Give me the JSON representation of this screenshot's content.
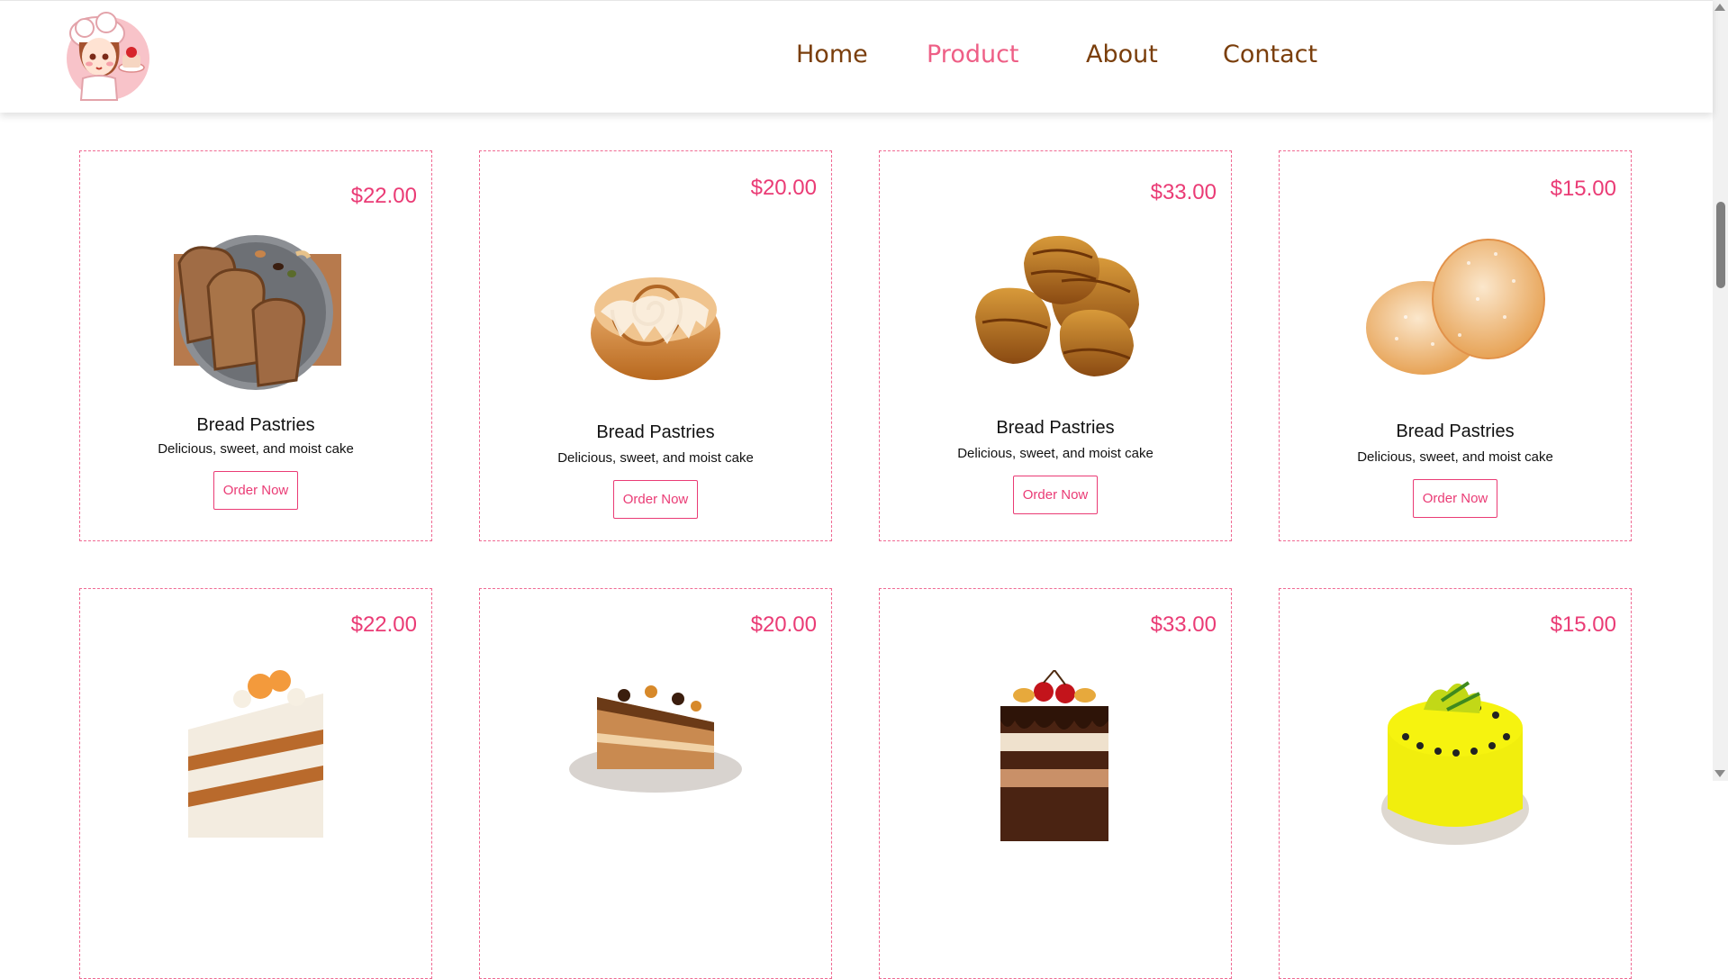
{
  "nav": {
    "items": [
      {
        "label": "Home",
        "active": false
      },
      {
        "label": "Product",
        "active": true
      },
      {
        "label": "About",
        "active": false
      },
      {
        "label": "Contact",
        "active": false
      }
    ]
  },
  "products": [
    {
      "price": "$22.00",
      "title": "Bread Pastries",
      "description": "Delicious, sweet, and moist cake",
      "button": "Order Now",
      "image": "bread-slices"
    },
    {
      "price": "$20.00",
      "title": "Bread Pastries",
      "description": "Delicious, sweet, and moist cake",
      "button": "Order Now",
      "image": "cinnamon-roll"
    },
    {
      "price": "$33.00",
      "title": "Bread Pastries",
      "description": "Delicious, sweet, and moist cake",
      "button": "Order Now",
      "image": "croissants"
    },
    {
      "price": "$15.00",
      "title": "Bread Pastries",
      "description": "Delicious, sweet, and moist cake",
      "button": "Order Now",
      "image": "donuts"
    },
    {
      "price": "$22.00",
      "image": "carrot-cake"
    },
    {
      "price": "$20.00",
      "image": "caramel-cake"
    },
    {
      "price": "$33.00",
      "image": "cherry-chocolate-cake"
    },
    {
      "price": "$15.00",
      "image": "lemon-cake"
    }
  ],
  "colors": {
    "accent": "#ea3b75",
    "nav_text": "#7a3e0b",
    "nav_active": "#ee5f86"
  }
}
